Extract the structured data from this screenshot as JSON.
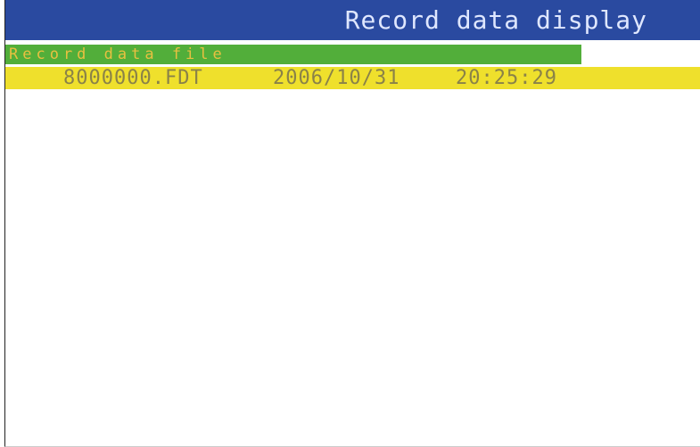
{
  "window": {
    "title": "Record data display"
  },
  "section": {
    "label": "Record data file"
  },
  "files": [
    {
      "name": "8000000.FDT",
      "date": "2006/10/31",
      "time": "20:25:29"
    }
  ],
  "colors": {
    "title_bar": "#2a4aa0",
    "section_header": "#52ae3a",
    "selected_row": "#efe02c",
    "background": "#ffffff"
  }
}
